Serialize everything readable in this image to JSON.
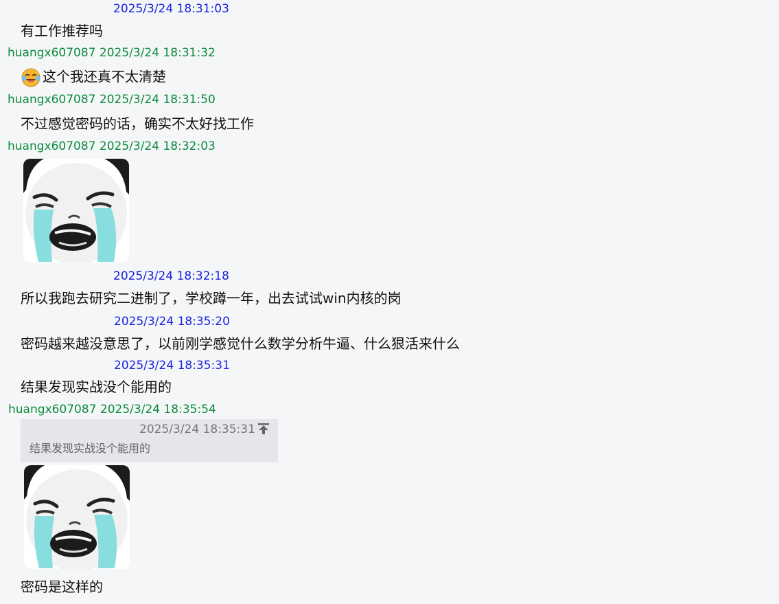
{
  "messages": [
    {
      "sender": "",
      "time": "2025/3/24 18:31:03",
      "text": "有工作推荐吗"
    },
    {
      "sender": "huangx607087",
      "time": "2025/3/24 18:31:32",
      "text": "这个我还真不太清楚",
      "emoji": "crying-laughing-emoji-icon"
    },
    {
      "sender": "huangx607087",
      "time": "2025/3/24 18:31:50",
      "text": "不过感觉密码的话，确实不太好找工作"
    },
    {
      "sender": "huangx607087",
      "time": "2025/3/24 18:32:03",
      "sticker": "crying-panda-sticker"
    },
    {
      "sender": "",
      "time": "2025/3/24 18:32:18",
      "text": "所以我跑去研究二进制了，学校蹲一年，出去试试win内核的岗"
    },
    {
      "sender": "",
      "time": "2025/3/24 18:35:20",
      "text": "密码越来越没意思了，以前刚学感觉什么数学分析牛逼、什么狠活来什么"
    },
    {
      "sender": "",
      "time": "2025/3/24 18:35:31",
      "text": "结果发现实战没个能用的"
    },
    {
      "sender": "huangx607087",
      "time": "2025/3/24 18:35:54",
      "quote": {
        "time": "2025/3/24 18:35:31",
        "text": "结果发现实战没个能用的",
        "jump_icon": "jump-to-top-icon"
      },
      "sticker": "crying-panda-sticker",
      "text": "密码是这样的"
    }
  ],
  "colors": {
    "background": "#f4f6f8",
    "self_header": "#1a22e0",
    "other_header": "#0b8a3a",
    "quote_background": "#e4e6ea"
  }
}
